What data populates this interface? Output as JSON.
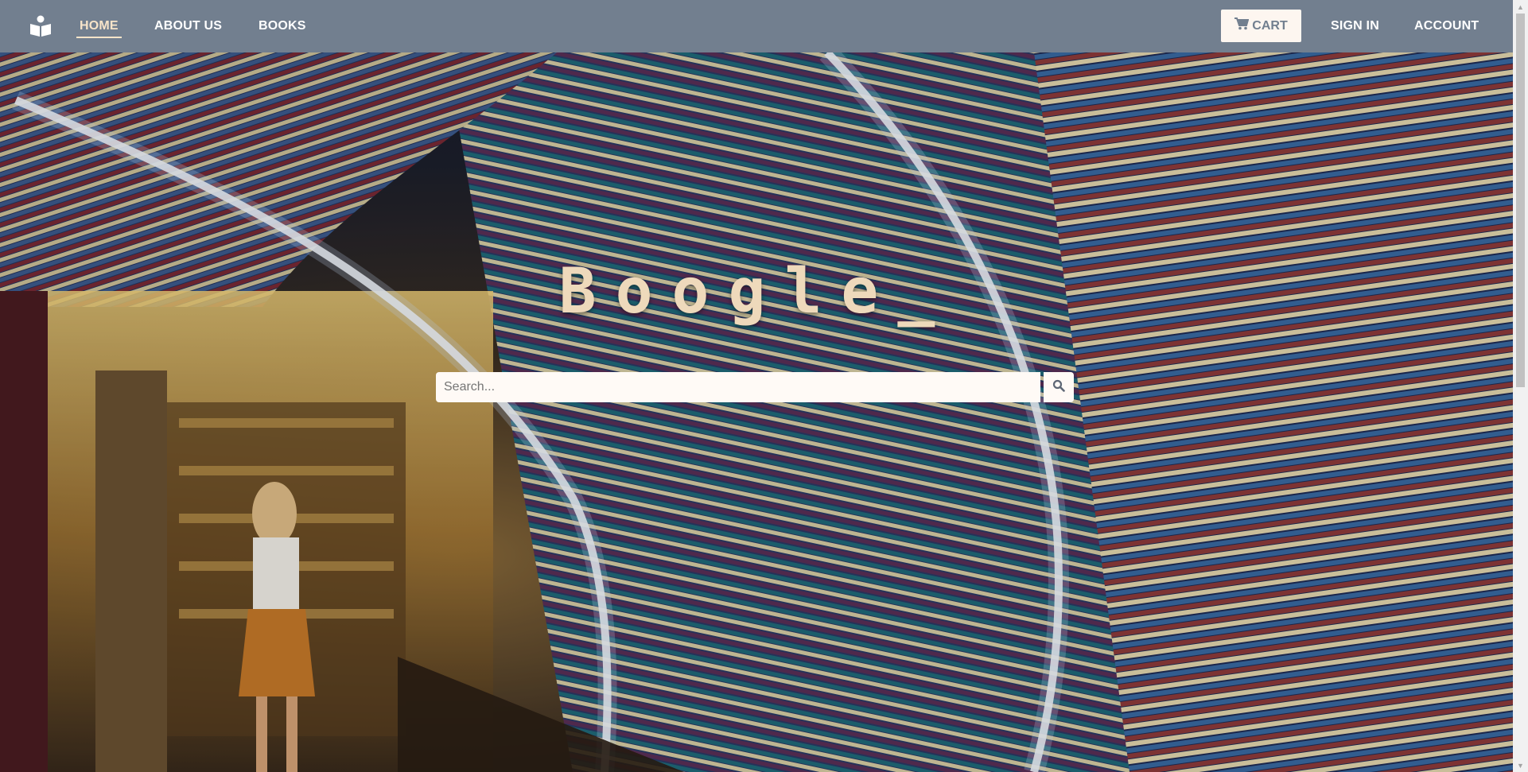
{
  "nav": {
    "brand_icon": "book-reader-icon",
    "links": [
      {
        "label": "HOME",
        "active": true
      },
      {
        "label": "ABOUT US",
        "active": false
      },
      {
        "label": "BOOKS",
        "active": false
      }
    ],
    "cart_label": "CART",
    "cart_icon": "shopping-cart-icon",
    "signin_label": "SIGN IN",
    "account_label": "ACCOUNT"
  },
  "hero": {
    "title": "Boogle_",
    "background": "book-tunnel-photo"
  },
  "search": {
    "placeholder": "Search...",
    "value": "",
    "button_icon": "search-icon"
  },
  "colors": {
    "navbar": "#727f8f",
    "accent": "#f7e4c9",
    "title": "#eed9bb",
    "input_bg": "#fffaf6"
  }
}
